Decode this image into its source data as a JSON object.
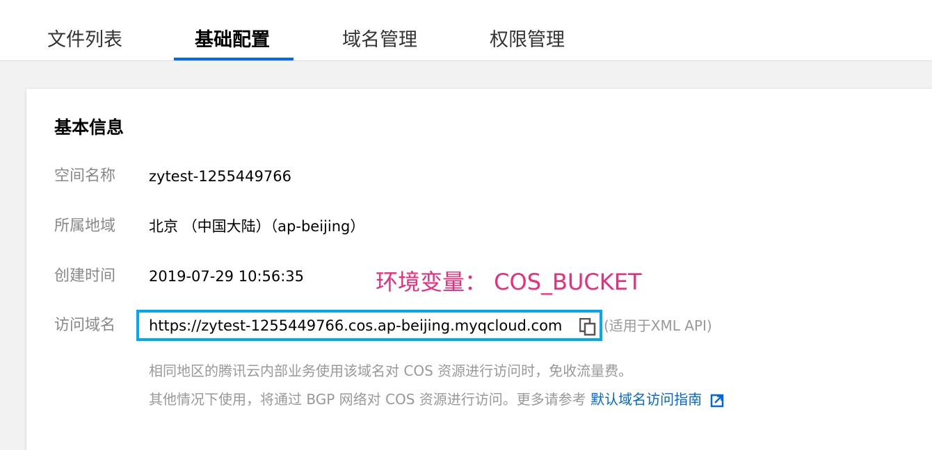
{
  "tabs": [
    {
      "label": "文件列表",
      "active": false
    },
    {
      "label": "基础配置",
      "active": true
    },
    {
      "label": "域名管理",
      "active": false
    },
    {
      "label": "权限管理",
      "active": false
    }
  ],
  "basic_info": {
    "title": "基本信息",
    "fields": [
      {
        "label": "空间名称",
        "value": "zytest-1255449766"
      },
      {
        "label": "所属地域",
        "value": "北京 （中国大陆）（ap-beijing）"
      },
      {
        "label": "创建时间",
        "value": "2019-07-29 10:56:35"
      },
      {
        "label": "访问域名",
        "value": "https://zytest-1255449766.cos.ap-beijing.myqcloud.com"
      }
    ],
    "xml_note": "(适用于XML API)",
    "note_line1": "相同地区的腾讯云内部业务使用该域名对 COS 资源进行访问时，免收流量费。",
    "note_line2": "其他情况下使用，将通过 BGP 网络对 COS 资源进行访问。更多请参考",
    "guide_link": "默认域名访问指南"
  },
  "annotation": "环境变量： COS_BUCKET",
  "icons": {
    "copy": "copy-icon",
    "external_link": "external-link-icon"
  },
  "colors": {
    "accent": "#0066ff",
    "annotation": "#ee2a7b",
    "highlight_border": "#00aaee",
    "link": "#0066dd"
  }
}
